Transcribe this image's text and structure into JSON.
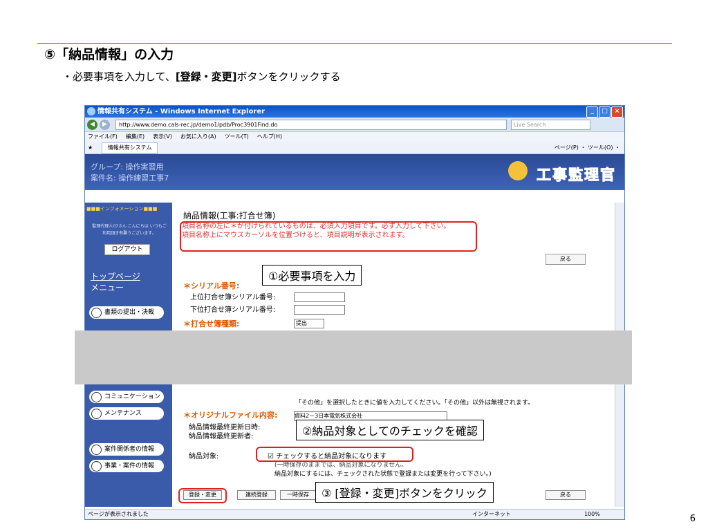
{
  "slide": {
    "title": "⑤「納品情報」の入力",
    "bullet_prefix": "・必要事項を入力して、",
    "bullet_bold": "[登録・変更]",
    "bullet_suffix": "ボタンをクリックする",
    "page_number": "6"
  },
  "browser": {
    "title": "情報共有システム - Windows Internet Explorer",
    "address": "http://www.demo.cals-rec.jp/demo1/pdb/Proc3901Find.do",
    "search_placeholder": "Live Search",
    "menu": [
      "ファイル(F)",
      "編集(E)",
      "表示(V)",
      "お気に入り(A)",
      "ツール(T)",
      "ヘルプ(H)"
    ],
    "tab_label": "情報共有システム",
    "tools_label": "ページ(P) ・ ツール(O) ・",
    "status_left": "ページが表示されました",
    "status_zone": "インターネット",
    "status_zoom": "100%"
  },
  "app": {
    "group": "グループ: 操作実習用",
    "project": "案件名: 操作練習工事7",
    "logo": "工事監理官"
  },
  "sidebar": {
    "info_label": "インフォメーション",
    "greeting": "監理代理人07さん こんにちは いつもご利用頂き有難うございます。",
    "logout": "ログアウト",
    "top_link": "トップページ",
    "menu_label": "メニュー",
    "items": [
      {
        "label": "書類の提出・決裁"
      },
      {
        "label": "コミュニケーション"
      },
      {
        "label": "メンテナンス"
      },
      {
        "label": "案件関係者の情報"
      },
      {
        "label": "事業・案件の情報"
      }
    ]
  },
  "main": {
    "heading": "納品情報(工事:打合せ簿)",
    "notice_line1": "項目名称の左に＊が付けられているものは、必須入力項目です。必ず入力して下さい。",
    "notice_line2": "項目名称上にマウスカーソルを位置づけると、項目説明が表示されます。",
    "back_label": "戻る",
    "serial_label": "＊シリアル番号:",
    "upper_serial_label": "上位打合せ簿シリアル番号:",
    "lower_serial_label": "下位打合せ簿シリアル番号:",
    "type_label": "＊打合せ簿種類:",
    "type_value": "提出",
    "other_note": "「その他」を選択したときに値を入力してください。「その他」以外は無視されます。",
    "original_file_label": "＊オリジナルファイル内容:",
    "original_file_value": "資料2－3日本電気株式会社",
    "updated_at_label": "納品情報最終更新日時:",
    "updated_by_label": "納品情報最終更新者:",
    "delivery_label": "納品対象:",
    "delivery_check_text": "チェックすると納品対象になります",
    "delivery_note1": "(一時保存のままでは、納品対象になりません。",
    "delivery_note2": "納品対象にするには、チェックされた状態で登録または変更を行って下さい。)",
    "btn_register": "登録・変更",
    "btn_continuous": "連続登録",
    "btn_temp": "一時保存",
    "back_label_bottom": "戻る"
  },
  "callouts": {
    "c1": "①必要事項を入力",
    "c2": "②納品対象としてのチェックを確認",
    "c3": "③ [登録・変更]ボタンをクリック"
  }
}
